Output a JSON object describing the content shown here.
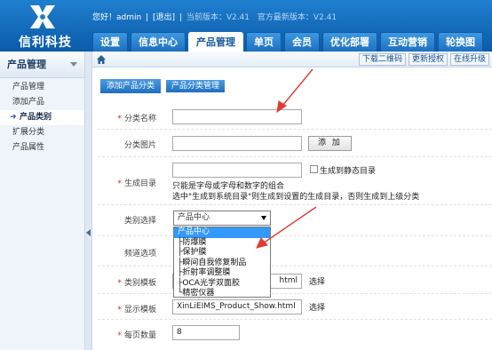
{
  "header": {
    "logo_text": "信利科技",
    "greeting": "您好！admin",
    "logout": "[退出]",
    "current_version": "当前版本：V2.41",
    "latest_version": "官方最新版本：V2.41"
  },
  "nav": {
    "tabs": [
      {
        "label": "设置"
      },
      {
        "label": "信息中心"
      },
      {
        "label": "产品管理"
      },
      {
        "label": "单页"
      },
      {
        "label": "会员"
      },
      {
        "label": "优化部署"
      },
      {
        "label": "互动营销"
      },
      {
        "label": "轮换图"
      }
    ]
  },
  "sidebar": {
    "title": "产品管理",
    "items": [
      {
        "label": "产品管理"
      },
      {
        "label": "添加产品"
      },
      {
        "label": "产品类别"
      },
      {
        "label": "扩展分类"
      },
      {
        "label": "产品属性"
      }
    ]
  },
  "toolbar": {
    "links": [
      {
        "label": "下载二维码"
      },
      {
        "label": "更新授权"
      },
      {
        "label": "在线升级"
      }
    ]
  },
  "tabs": {
    "add_category": "添加产品分类",
    "manage_category": "产品分类管理"
  },
  "form": {
    "category_name_label": "分类名称",
    "category_name_value": "",
    "category_image_label": "分类图片",
    "category_image_value": "",
    "add_button": "添 加",
    "gen_dir_label": "生成目录",
    "gen_dir_value": "",
    "gen_static_checkbox": "生成到静态目录",
    "gen_hint_1": "只能是字母或字母和数字的组合",
    "gen_hint_2": "选中\"生成到系统目录\"则生成到设置的生成目录，否则生成到上级分类",
    "category_select_label": "类别选择",
    "category_select_value": "产品中心",
    "dropdown_options": [
      "产品中心",
      "├防爆膜",
      "├保护膜",
      "├瞬间自我修复制品",
      "├折射率调整膜",
      "├OCA光学双面胶",
      "└精密仪器"
    ],
    "channel_label": "频道选项",
    "cat_template_label": "类别模板",
    "cat_template_value": "html",
    "display_template_label": "显示模板",
    "display_template_value": "XinLiEIMS_Product_Show.html",
    "choose": "选择",
    "per_page_label": "每页数量",
    "per_page_value": "8"
  },
  "colors": {
    "header_blue": "#0b5ba9",
    "accent_blue": "#1f6fbf",
    "annotation_red": "#e53935",
    "dropdown_highlight": "#3399ff"
  }
}
